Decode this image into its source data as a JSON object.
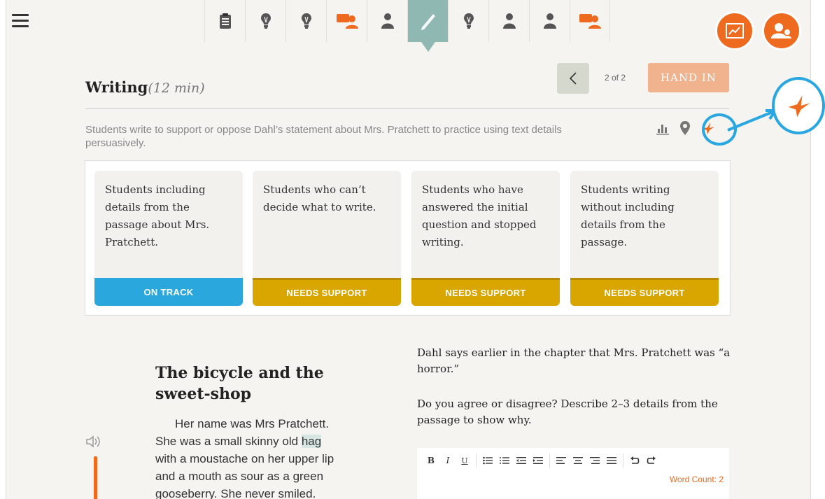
{
  "nav": {
    "items": [
      {
        "icon": "clipboard-icon",
        "active": false
      },
      {
        "icon": "lightbulb-icon",
        "active": false
      },
      {
        "icon": "lightbulb-icon",
        "active": false
      },
      {
        "icon": "discussion-icon",
        "active": false
      },
      {
        "icon": "student-icon",
        "active": false
      },
      {
        "icon": "pencil-icon",
        "active": true
      },
      {
        "icon": "lightbulb-icon",
        "active": false
      },
      {
        "icon": "student-icon",
        "active": false
      },
      {
        "icon": "student-icon",
        "active": false
      },
      {
        "icon": "discussion-icon",
        "active": false
      }
    ]
  },
  "section": {
    "title": "Writing",
    "duration": "(12 min)",
    "page_indicator": "2 of 2",
    "hand_in": "HAND IN",
    "description": "Students write to support or oppose Dahl’s statement about Mrs. Pratchett to practice using text details persuasively."
  },
  "cards": [
    {
      "text": "Students including details from the passage about Mrs. Pratchett.",
      "status": "ON TRACK",
      "kind": "on"
    },
    {
      "text": "Students who can’t decide what to write.",
      "status": "NEEDS SUPPORT",
      "kind": "need"
    },
    {
      "text": "Students who have answered the initial question and stopped writing.",
      "status": "NEEDS SUPPORT",
      "kind": "need"
    },
    {
      "text": "Students writing without including details from the passage.",
      "status": "NEEDS SUPPORT",
      "kind": "need"
    }
  ],
  "story": {
    "title": "The bicycle and the sweet-shop",
    "line1": "Her name was Mrs Pratchett.",
    "line2_pre": "She was a small skinny old ",
    "line2_hl": "hag",
    "line3": "with a moustache on her upper lip",
    "line4": "and a mouth as sour as a green",
    "line5": "gooseberry. She never smiled."
  },
  "prompt": {
    "p1": "Dahl says earlier in the chapter that Mrs. Pratchett was “a horror.”",
    "p2": "Do you agree or disagree? Describe 2–3 details from the passage to show why."
  },
  "editor": {
    "bold": "B",
    "italic": "I",
    "underline": "U",
    "word_count": "Word Count: 2"
  },
  "colors": {
    "accent": "#ee6a1f",
    "on_track": "#2aa7dc",
    "needs_support": "#d9a600",
    "highlight": "#2aa7e0"
  }
}
